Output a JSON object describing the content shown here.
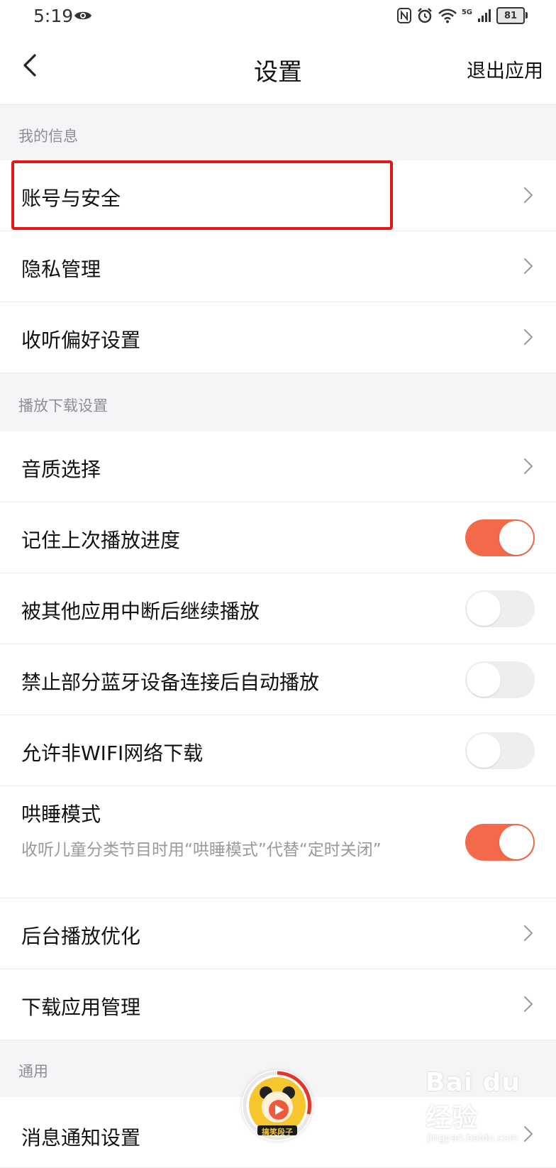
{
  "status_bar": {
    "time": "5:19",
    "battery": "81",
    "signal_label": "5G"
  },
  "header": {
    "title": "设置",
    "exit_label": "退出应用"
  },
  "sections": {
    "my_info": {
      "title": "我的信息",
      "items": [
        {
          "label": "账号与安全"
        },
        {
          "label": "隐私管理"
        },
        {
          "label": "收听偏好设置"
        }
      ]
    },
    "playback": {
      "title": "播放下载设置",
      "items": [
        {
          "label": "音质选择"
        },
        {
          "label": "记住上次播放进度",
          "toggle": true
        },
        {
          "label": "被其他应用中断后继续播放",
          "toggle": false
        },
        {
          "label": "禁止部分蓝牙设备连接后自动播放",
          "toggle": false
        },
        {
          "label": "允许非WIFI网络下载",
          "toggle": false
        },
        {
          "label": "哄睡模式",
          "description": "收听儿童分类节目时用“哄睡模式”代替“定时关闭”",
          "toggle": true
        },
        {
          "label": "后台播放优化"
        },
        {
          "label": "下载应用管理"
        }
      ]
    },
    "general": {
      "title": "通用",
      "items": [
        {
          "label": "消息通知设置"
        }
      ]
    }
  },
  "player": {
    "label": "搞笑段子"
  },
  "watermark": {
    "main": "Bai du 经验",
    "url": "jingyan.baidu.com"
  },
  "colors": {
    "accent": "#f4694a",
    "highlight": "#e21818",
    "section_bg": "#f5f5f7"
  }
}
